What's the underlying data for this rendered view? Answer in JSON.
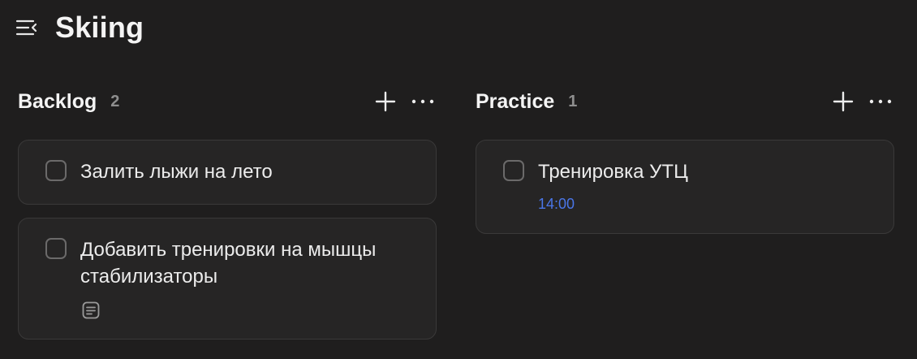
{
  "header": {
    "title": "Skiing",
    "menu_icon": "sidebar-toggle-icon"
  },
  "colors": {
    "background": "#1f1e1e",
    "card": "#262525",
    "card_border": "#3a3939",
    "time_accent": "#4a76e8",
    "count_text": "#8e8e8e"
  },
  "columns": [
    {
      "name": "Backlog",
      "count": "2",
      "add_icon": "plus-icon",
      "more_icon": "more-horizontal-icon",
      "cards": [
        {
          "text": "Залить лыжи на лето",
          "done": false
        },
        {
          "text": "Добавить тренировки на мышцы стабилизаторы",
          "done": false,
          "icon": "note-icon"
        }
      ]
    },
    {
      "name": "Practice",
      "count": "1",
      "add_icon": "plus-icon",
      "more_icon": "more-horizontal-icon",
      "cards": [
        {
          "text": "Тренировка УТЦ",
          "time": "14:00",
          "done": false
        }
      ]
    }
  ]
}
